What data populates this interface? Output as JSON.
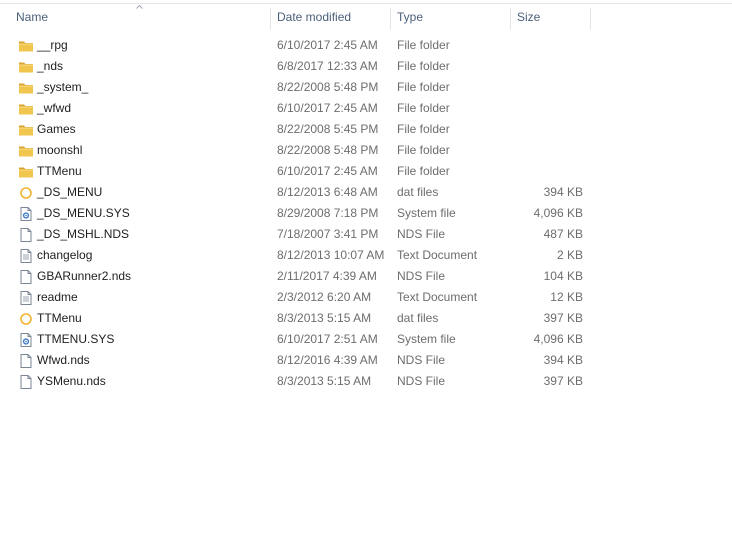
{
  "columns": {
    "name": "Name",
    "date": "Date modified",
    "type": "Type",
    "size": "Size"
  },
  "files": [
    {
      "name": "__rpg",
      "date": "6/10/2017 2:45 AM",
      "type": "File folder",
      "size": "",
      "icon": "folder-icon"
    },
    {
      "name": "_nds",
      "date": "6/8/2017 12:33 AM",
      "type": "File folder",
      "size": "",
      "icon": "folder-icon"
    },
    {
      "name": "_system_",
      "date": "8/22/2008 5:48 PM",
      "type": "File folder",
      "size": "",
      "icon": "folder-icon"
    },
    {
      "name": "_wfwd",
      "date": "6/10/2017 2:45 AM",
      "type": "File folder",
      "size": "",
      "icon": "folder-icon"
    },
    {
      "name": "Games",
      "date": "8/22/2008 5:45 PM",
      "type": "File folder",
      "size": "",
      "icon": "folder-icon"
    },
    {
      "name": "moonshl",
      "date": "8/22/2008 5:48 PM",
      "type": "File folder",
      "size": "",
      "icon": "folder-icon"
    },
    {
      "name": "TTMenu",
      "date": "6/10/2017 2:45 AM",
      "type": "File folder",
      "size": "",
      "icon": "folder-icon"
    },
    {
      "name": "_DS_MENU",
      "date": "8/12/2013 6:48 AM",
      "type": "dat files",
      "size": "394 KB",
      "icon": "dat-file-icon"
    },
    {
      "name": "_DS_MENU.SYS",
      "date": "8/29/2008 7:18 PM",
      "type": "System file",
      "size": "4,096 KB",
      "icon": "system-file-icon"
    },
    {
      "name": "_DS_MSHL.NDS",
      "date": "7/18/2007 3:41 PM",
      "type": "NDS File",
      "size": "487 KB",
      "icon": "file-icon"
    },
    {
      "name": "changelog",
      "date": "8/12/2013 10:07 AM",
      "type": "Text Document",
      "size": "2 KB",
      "icon": "text-document-icon"
    },
    {
      "name": "GBARunner2.nds",
      "date": "2/11/2017 4:39 AM",
      "type": "NDS File",
      "size": "104 KB",
      "icon": "file-icon"
    },
    {
      "name": "readme",
      "date": "2/3/2012 6:20 AM",
      "type": "Text Document",
      "size": "12 KB",
      "icon": "text-document-icon"
    },
    {
      "name": "TTMenu",
      "date": "8/3/2013 5:15 AM",
      "type": "dat files",
      "size": "397 KB",
      "icon": "dat-file-icon"
    },
    {
      "name": "TTMENU.SYS",
      "date": "6/10/2017 2:51 AM",
      "type": "System file",
      "size": "4,096 KB",
      "icon": "system-file-icon"
    },
    {
      "name": "Wfwd.nds",
      "date": "8/12/2016 4:39 AM",
      "type": "NDS File",
      "size": "394 KB",
      "icon": "file-icon"
    },
    {
      "name": "YSMenu.nds",
      "date": "8/3/2013 5:15 AM",
      "type": "NDS File",
      "size": "397 KB",
      "icon": "file-icon"
    }
  ],
  "sort": {
    "column": "name",
    "direction": "ascending"
  },
  "colors": {
    "header_text": "#4c607a",
    "name_text": "#1e1e1e",
    "detail_text": "#6d6d6d",
    "folder": "#e8b93a",
    "dat_ring": "#f2b431"
  }
}
